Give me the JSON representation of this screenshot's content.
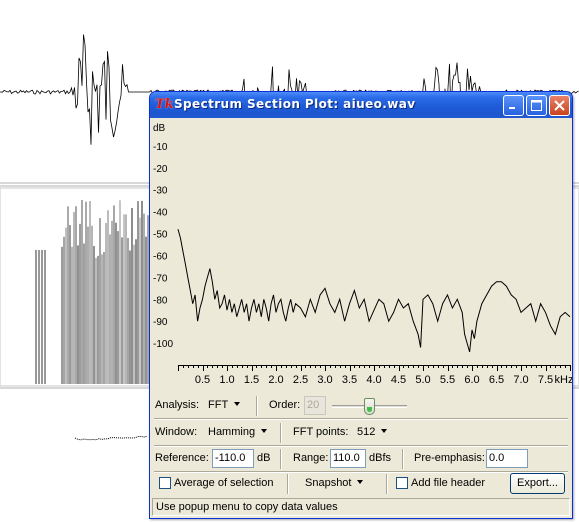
{
  "window": {
    "logo": "Tk",
    "title": "Spectrum Section Plot: aiueo.wav"
  },
  "colors": {
    "title_bar": "#1f5bd7",
    "window_bg": "#ece9d8",
    "close_button": "#c8431e",
    "thumb_green": "#3fbf4a"
  },
  "chart_data": {
    "type": "line",
    "title": "",
    "ylabel": "dB",
    "xlabel": "",
    "x_unit": "kHz",
    "xlim": [
      0,
      8.0
    ],
    "ylim": [
      -110,
      0
    ],
    "y_ticks": [
      -10,
      -20,
      -30,
      -40,
      -50,
      -60,
      -70,
      -80,
      -90,
      -100
    ],
    "y_tick_labels": [
      "-10",
      "-20",
      "-30",
      "-40",
      "-50",
      "-60",
      "-70",
      "-80",
      "-90",
      "-100"
    ],
    "x_ticks": [
      0.5,
      1.0,
      1.5,
      2.0,
      2.5,
      3.0,
      3.5,
      4.0,
      4.5,
      5.0,
      5.5,
      6.0,
      6.5,
      7.0,
      7.5
    ],
    "x_tick_labels": [
      "0.5",
      "1.0",
      "1.5",
      "2.0",
      "2.5",
      "3.0",
      "3.5",
      "4.0",
      "4.5",
      "5.0",
      "5.5",
      "6.0",
      "6.5",
      "7.0",
      "7.5"
    ],
    "x_end_label": "kHz",
    "series": [
      {
        "x": [
          0.0,
          0.05,
          0.1,
          0.15,
          0.2,
          0.25,
          0.3,
          0.35,
          0.4,
          0.45,
          0.5,
          0.55,
          0.6,
          0.65,
          0.7,
          0.75,
          0.8,
          0.85,
          0.9,
          0.95,
          1.0,
          1.05,
          1.1,
          1.15,
          1.2,
          1.25,
          1.3,
          1.35,
          1.4,
          1.45,
          1.5,
          1.55,
          1.6,
          1.65,
          1.7,
          1.75,
          1.8,
          1.85,
          1.9,
          1.95,
          2.0,
          2.05,
          2.1,
          2.15,
          2.2,
          2.25,
          2.3,
          2.35,
          2.4,
          2.5,
          2.6,
          2.7,
          2.8,
          2.9,
          3.0,
          3.1,
          3.2,
          3.3,
          3.4,
          3.5,
          3.6,
          3.7,
          3.8,
          3.9,
          4.0,
          4.1,
          4.2,
          4.3,
          4.4,
          4.5,
          4.6,
          4.7,
          4.8,
          4.9,
          4.95,
          5.0,
          5.1,
          5.2,
          5.3,
          5.4,
          5.5,
          5.6,
          5.7,
          5.8,
          5.85,
          5.9,
          5.95,
          6.0,
          6.05,
          6.1,
          6.2,
          6.3,
          6.4,
          6.5,
          6.6,
          6.7,
          6.8,
          6.9,
          7.0,
          7.1,
          7.2,
          7.3,
          7.4,
          7.5,
          7.6,
          7.7,
          7.8,
          7.9,
          8.0
        ],
        "y": [
          -48,
          -52,
          -58,
          -64,
          -70,
          -76,
          -82,
          -78,
          -90,
          -84,
          -80,
          -74,
          -70,
          -66,
          -72,
          -80,
          -76,
          -84,
          -82,
          -78,
          -85,
          -80,
          -86,
          -82,
          -88,
          -84,
          -80,
          -86,
          -82,
          -90,
          -84,
          -80,
          -86,
          -82,
          -88,
          -80,
          -84,
          -90,
          -82,
          -78,
          -86,
          -82,
          -80,
          -86,
          -90,
          -84,
          -80,
          -86,
          -82,
          -84,
          -88,
          -80,
          -86,
          -78,
          -75,
          -82,
          -86,
          -80,
          -90,
          -82,
          -76,
          -84,
          -80,
          -90,
          -85,
          -80,
          -82,
          -90,
          -86,
          -80,
          -84,
          -82,
          -90,
          -96,
          -102,
          -80,
          -78,
          -82,
          -90,
          -82,
          -78,
          -84,
          -80,
          -86,
          -96,
          -100,
          -104,
          -94,
          -98,
          -90,
          -82,
          -78,
          -74,
          -72,
          -72,
          -74,
          -78,
          -80,
          -86,
          -84,
          -82,
          -90,
          -82,
          -86,
          -92,
          -96,
          -88,
          -86,
          -88
        ]
      }
    ]
  },
  "controls": {
    "analysis_label": "Analysis:",
    "analysis_value": "FFT",
    "order_label": "Order:",
    "order_value": "20",
    "order_level": 0.5,
    "window_label": "Window:",
    "window_value": "Hamming",
    "fft_points_label": "FFT points:",
    "fft_points_value": "512",
    "reference_label": "Reference:",
    "reference_value": "-110.0",
    "reference_unit": "dB",
    "range_label": "Range:",
    "range_value": "110.0",
    "range_unit": "dBfs",
    "preemphasis_label": "Pre-emphasis:",
    "preemphasis_value": "0.0",
    "average_label": "Average of selection",
    "snapshot_label": "Snapshot",
    "add_header_label": "Add file header",
    "export_label": "Export..."
  },
  "status": "Use popup menu to copy data values"
}
